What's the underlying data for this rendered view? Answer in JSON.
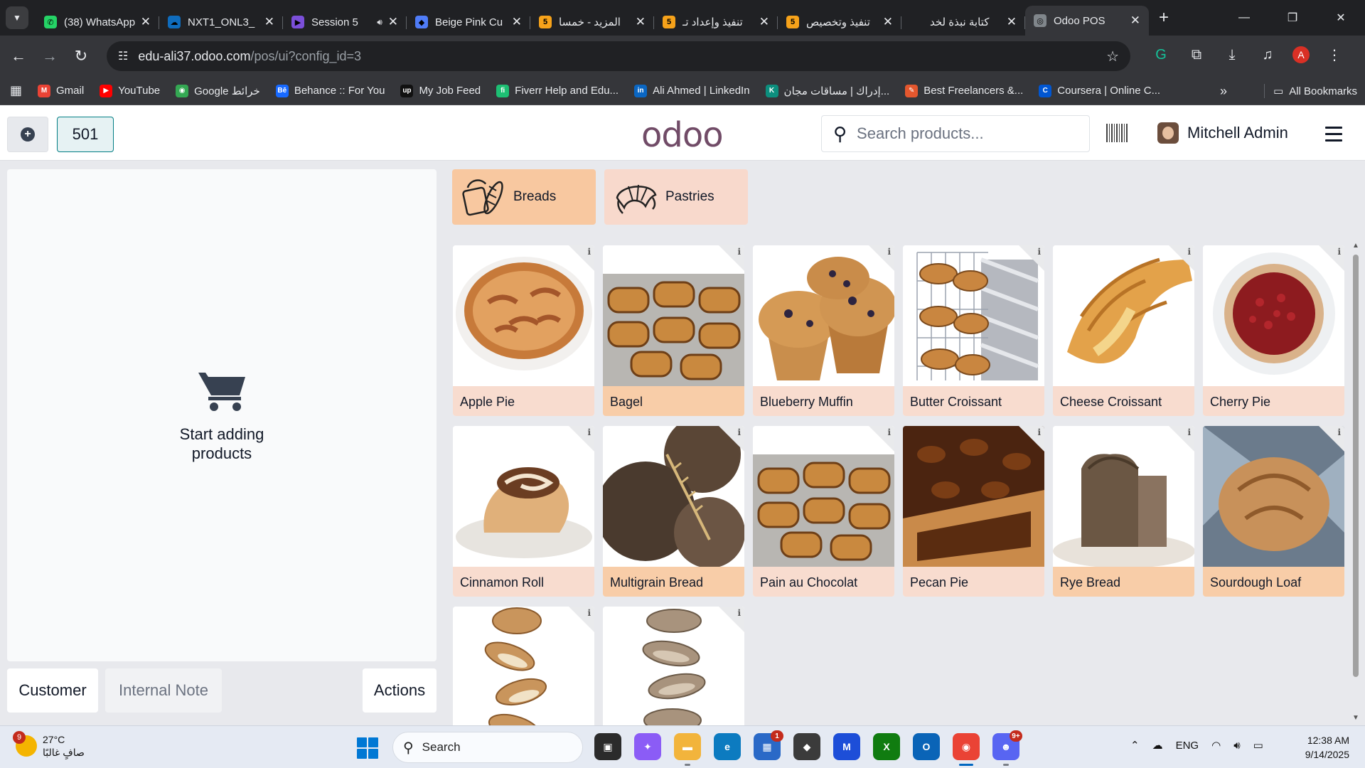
{
  "browser": {
    "tabs": [
      {
        "title": "(38) WhatsApp",
        "favicon_color": "#25d366",
        "favicon_char": "✆",
        "audio": false
      },
      {
        "title": "NXT1_ONL3_",
        "favicon_color": "#0f6cbd",
        "favicon_char": "☁",
        "audio": false
      },
      {
        "title": "Session 5",
        "favicon_color": "#7b4fd9",
        "favicon_char": "▶",
        "audio": true
      },
      {
        "title": "Beige Pink Cu",
        "favicon_color": "#4f7cf7",
        "favicon_char": "◆",
        "audio": false
      },
      {
        "title": "المزيد - خمسا",
        "favicon_color": "#f6a21a",
        "favicon_char": "5",
        "audio": false
      },
      {
        "title": "تنفيذ وإعداد تـ",
        "favicon_color": "#f6a21a",
        "favicon_char": "5",
        "audio": false
      },
      {
        "title": "تنفيذ وتخصيص",
        "favicon_color": "#f6a21a",
        "favicon_char": "5",
        "audio": false
      },
      {
        "title": "كتابة نبذة لخد",
        "favicon_color": "#202124",
        "favicon_char": "",
        "audio": false
      },
      {
        "title": "Odoo POS",
        "favicon_color": "#80868b",
        "favicon_char": "◎",
        "audio": false,
        "active": true
      }
    ],
    "url_host": "edu-ali37.odoo.com",
    "url_path": "/pos/ui?config_id=3",
    "profile_initial": "A",
    "bookmarks": [
      {
        "label": "Gmail",
        "color": "#ea4335",
        "char": "M"
      },
      {
        "label": "YouTube",
        "color": "#ff0000",
        "char": "▶"
      },
      {
        "label": "Google خرائط",
        "color": "#34a853",
        "char": "◉"
      },
      {
        "label": "Behance :: For You",
        "color": "#1769ff",
        "char": "Bē"
      },
      {
        "label": "My Job Feed",
        "color": "#111111",
        "char": "up"
      },
      {
        "label": "Fiverr Help and Edu...",
        "color": "#1dbf73",
        "char": "fi"
      },
      {
        "label": "Ali Ahmed | LinkedIn",
        "color": "#0a66c2",
        "char": "in"
      },
      {
        "label": "إدراك | مساقات مجان...",
        "color": "#0c8f7e",
        "char": "K"
      },
      {
        "label": "Best Freelancers &...",
        "color": "#e4572e",
        "char": "✎"
      },
      {
        "label": "Coursera | Online C...",
        "color": "#0056d2",
        "char": "C"
      }
    ],
    "all_bookmarks": "All Bookmarks"
  },
  "pos": {
    "order_number": "501",
    "logo_text": "odoo",
    "search_placeholder": "Search products...",
    "user_name": "Mitchell Admin",
    "empty_cart_line1": "Start adding",
    "empty_cart_line2": "products",
    "buttons": {
      "customer": "Customer",
      "internal_note": "Internal Note",
      "actions": "Actions"
    },
    "categories": [
      {
        "name": "Breads",
        "color": "#f8c8a0"
      },
      {
        "name": "Pastries",
        "color": "#f8d9cc"
      }
    ],
    "products": [
      {
        "name": "Apple Pie",
        "category": "pastries",
        "img": "pie-apple"
      },
      {
        "name": "Bagel",
        "category": "breads",
        "img": "pastry-tray"
      },
      {
        "name": "Blueberry Muffin",
        "category": "pastries",
        "img": "muffin"
      },
      {
        "name": "Butter Croissant",
        "category": "pastries",
        "img": "croissant-rack"
      },
      {
        "name": "Cheese Croissant",
        "category": "pastries",
        "img": "croissant"
      },
      {
        "name": "Cherry Pie",
        "category": "pastries",
        "img": "pie-cherry"
      },
      {
        "name": "Cinnamon Roll",
        "category": "pastries",
        "img": "roll"
      },
      {
        "name": "Multigrain Bread",
        "category": "breads",
        "img": "dark-bread"
      },
      {
        "name": "Pain au Chocolat",
        "category": "pastries",
        "img": "pastry-tray"
      },
      {
        "name": "Pecan Pie",
        "category": "pastries",
        "img": "pie-pecan"
      },
      {
        "name": "Rye Bread",
        "category": "breads",
        "img": "loaf"
      },
      {
        "name": "Sourdough Loaf",
        "category": "breads",
        "img": "sourdough"
      },
      {
        "name": "",
        "category": "breads",
        "img": "baguette-slices"
      },
      {
        "name": "",
        "category": "breads",
        "img": "bread-slices"
      }
    ]
  },
  "taskbar": {
    "weather_temp": "27°C",
    "weather_desc": "صافٍ غالبًا",
    "weather_badge": "9",
    "search_label": "Search",
    "lang": "ENG",
    "time": "12:38 AM",
    "date": "9/14/2025",
    "apps": [
      {
        "name": "task-view",
        "color": "#2b2b2b",
        "char": "▣",
        "badge": ""
      },
      {
        "name": "copilot",
        "color": "#8b5cf6",
        "char": "✦",
        "badge": ""
      },
      {
        "name": "file-explorer",
        "color": "#f2b43c",
        "char": "▬",
        "badge": ""
      },
      {
        "name": "edge",
        "color": "#0c7bc0",
        "char": "e",
        "badge": ""
      },
      {
        "name": "store",
        "color": "#2a69c7",
        "char": "▦",
        "badge": "1"
      },
      {
        "name": "cube-app",
        "color": "#3b3b3b",
        "char": "◆",
        "badge": ""
      },
      {
        "name": "visual-studio-app",
        "color": "#1d4ed8",
        "char": "M",
        "badge": ""
      },
      {
        "name": "xbox",
        "color": "#107c10",
        "char": "X",
        "badge": ""
      },
      {
        "name": "outlook",
        "color": "#0a64b7",
        "char": "O",
        "badge": ""
      },
      {
        "name": "chrome",
        "color": "#ea4335",
        "char": "◉",
        "badge": "",
        "current": true
      },
      {
        "name": "discord",
        "color": "#5865f2",
        "char": "☻",
        "badge": "9+"
      }
    ]
  }
}
